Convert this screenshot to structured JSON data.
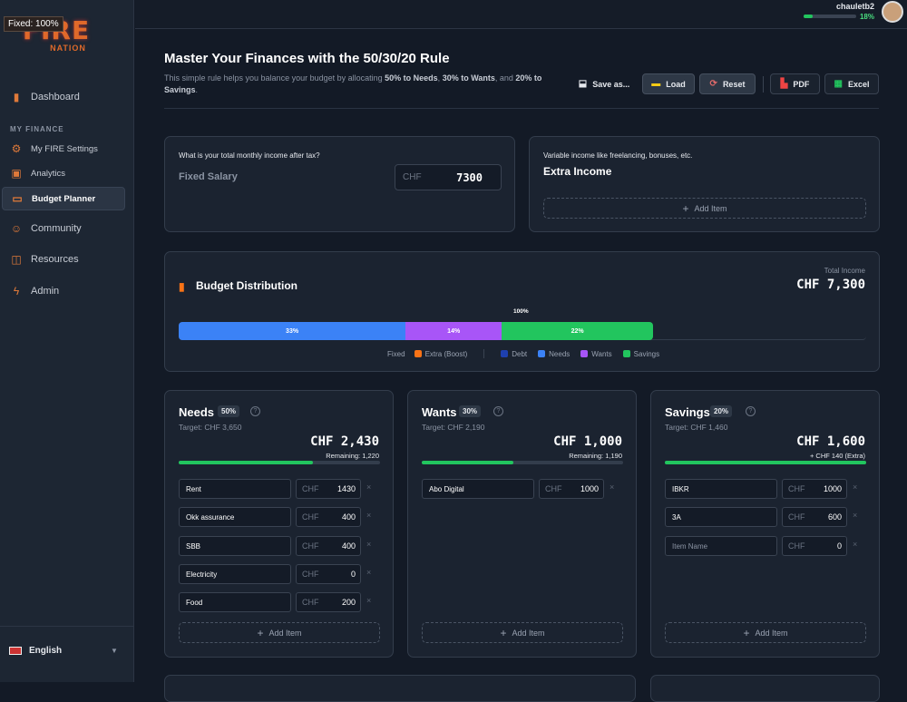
{
  "overlay": {
    "fixed_badge": "Fixed: 100%"
  },
  "sidebar": {
    "logo": {
      "line1": "FIRE",
      "line2": "NATION"
    },
    "section_label": "MY FINANCE",
    "items": [
      {
        "label": "Dashboard",
        "icon": "bar-chart-icon"
      },
      {
        "label": "My FIRE Settings",
        "icon": "gear-icon"
      },
      {
        "label": "Analytics",
        "icon": "analytics-icon"
      },
      {
        "label": "Budget Planner",
        "icon": "budget-icon"
      },
      {
        "label": "Community",
        "icon": "users-icon"
      },
      {
        "label": "Resources",
        "icon": "book-icon"
      },
      {
        "label": "Admin",
        "icon": "bolt-icon"
      }
    ],
    "language": "English"
  },
  "topbar": {
    "username": "chauletb2",
    "progress_label": "18%",
    "progress": 0.18
  },
  "header": {
    "title": "Master Your Finances with the 50/30/20 Rule",
    "subtitle_1": "This simple rule helps you balance your budget by allocating ",
    "needs": "50% to Needs",
    "sep1": ", ",
    "wants": "30% to Wants",
    "sep2": ", and ",
    "savings": "20% to Savings",
    "end": ".",
    "buttons": {
      "save": "Save as...",
      "load": "Load",
      "reset": "Reset",
      "pdf": "PDF",
      "excel": "Excel"
    }
  },
  "income": {
    "question": "What is your total monthly income after tax?",
    "fixed_label": "Fixed Salary",
    "currency": "CHF",
    "fixed_value": "7300",
    "extra_question": "Variable income like freelancing, bonuses, etc.",
    "extra_label": "Extra Income",
    "add_item": "Add Item"
  },
  "distribution": {
    "title": "Budget Distribution",
    "total_label": "Total Income",
    "total_value": "CHF 7,300",
    "marker_label": "100%",
    "segments": [
      {
        "name": "Needs",
        "label": "33%",
        "value": 33,
        "color": "#3b82f6"
      },
      {
        "name": "Wants",
        "label": "14%",
        "value": 14,
        "color": "#a855f7"
      },
      {
        "name": "Savings",
        "label": "22%",
        "value": 22,
        "color": "#22c55e"
      }
    ],
    "legend": {
      "fixed": "Fixed",
      "extra": "Extra (Boost)",
      "debt": "Debt",
      "needs": "Needs",
      "wants": "Wants",
      "savings": "Savings"
    },
    "colors": {
      "extra": "#f97316",
      "debt": "#1e40af",
      "needs": "#3b82f6",
      "wants": "#a855f7",
      "savings": "#22c55e"
    }
  },
  "categories": [
    {
      "title": "Needs",
      "pct": "50%",
      "target": "Target: CHF 3,650",
      "amount": "CHF 2,430",
      "note": "Remaining: 1,220",
      "progress": 0.666,
      "items": [
        {
          "name": "Rent",
          "value": "1430"
        },
        {
          "name": "Okk assurance",
          "value": "400"
        },
        {
          "name": "SBB",
          "value": "400"
        },
        {
          "name": "Electricity",
          "value": "0"
        },
        {
          "name": "Food",
          "value": "200"
        }
      ]
    },
    {
      "title": "Wants",
      "pct": "30%",
      "target": "Target: CHF 2,190",
      "amount": "CHF 1,000",
      "note": "Remaining: 1,190",
      "progress": 0.457,
      "items": [
        {
          "name": "Abo Digital",
          "value": "1000"
        }
      ]
    },
    {
      "title": "Savings",
      "pct": "20%",
      "target": "Target: CHF 1,460",
      "amount": "CHF 1,600",
      "note": "+ CHF 140 (Extra)",
      "progress": 1.0,
      "items": [
        {
          "name": "IBKR",
          "value": "1000"
        },
        {
          "name": "3A",
          "value": "600"
        },
        {
          "name": "",
          "placeholder": "Item Name",
          "value": "0"
        }
      ]
    }
  ],
  "common": {
    "currency": "CHF",
    "add_item": "Add Item",
    "remove": "×",
    "help": "?"
  }
}
